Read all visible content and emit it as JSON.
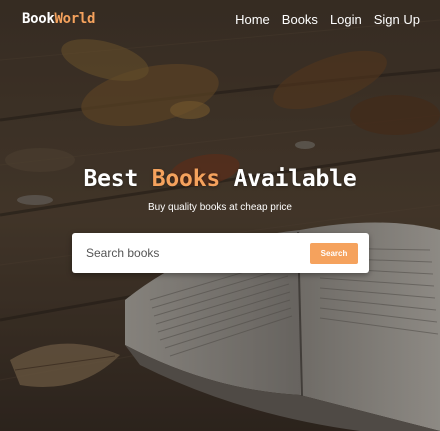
{
  "brand": {
    "part1": "Book",
    "part2": "World"
  },
  "nav": {
    "items": [
      {
        "label": "Home"
      },
      {
        "label": "Books"
      },
      {
        "label": "Login"
      },
      {
        "label": "Sign Up"
      }
    ]
  },
  "hero": {
    "headline_part1": "Best ",
    "headline_accent": "Books",
    "headline_part2": " Available",
    "subtitle": "Buy quality books at cheap price"
  },
  "search": {
    "placeholder": "Search books",
    "value": "",
    "button_label": "Search"
  },
  "colors": {
    "accent": "#f5a25d",
    "text": "#ffffff"
  }
}
